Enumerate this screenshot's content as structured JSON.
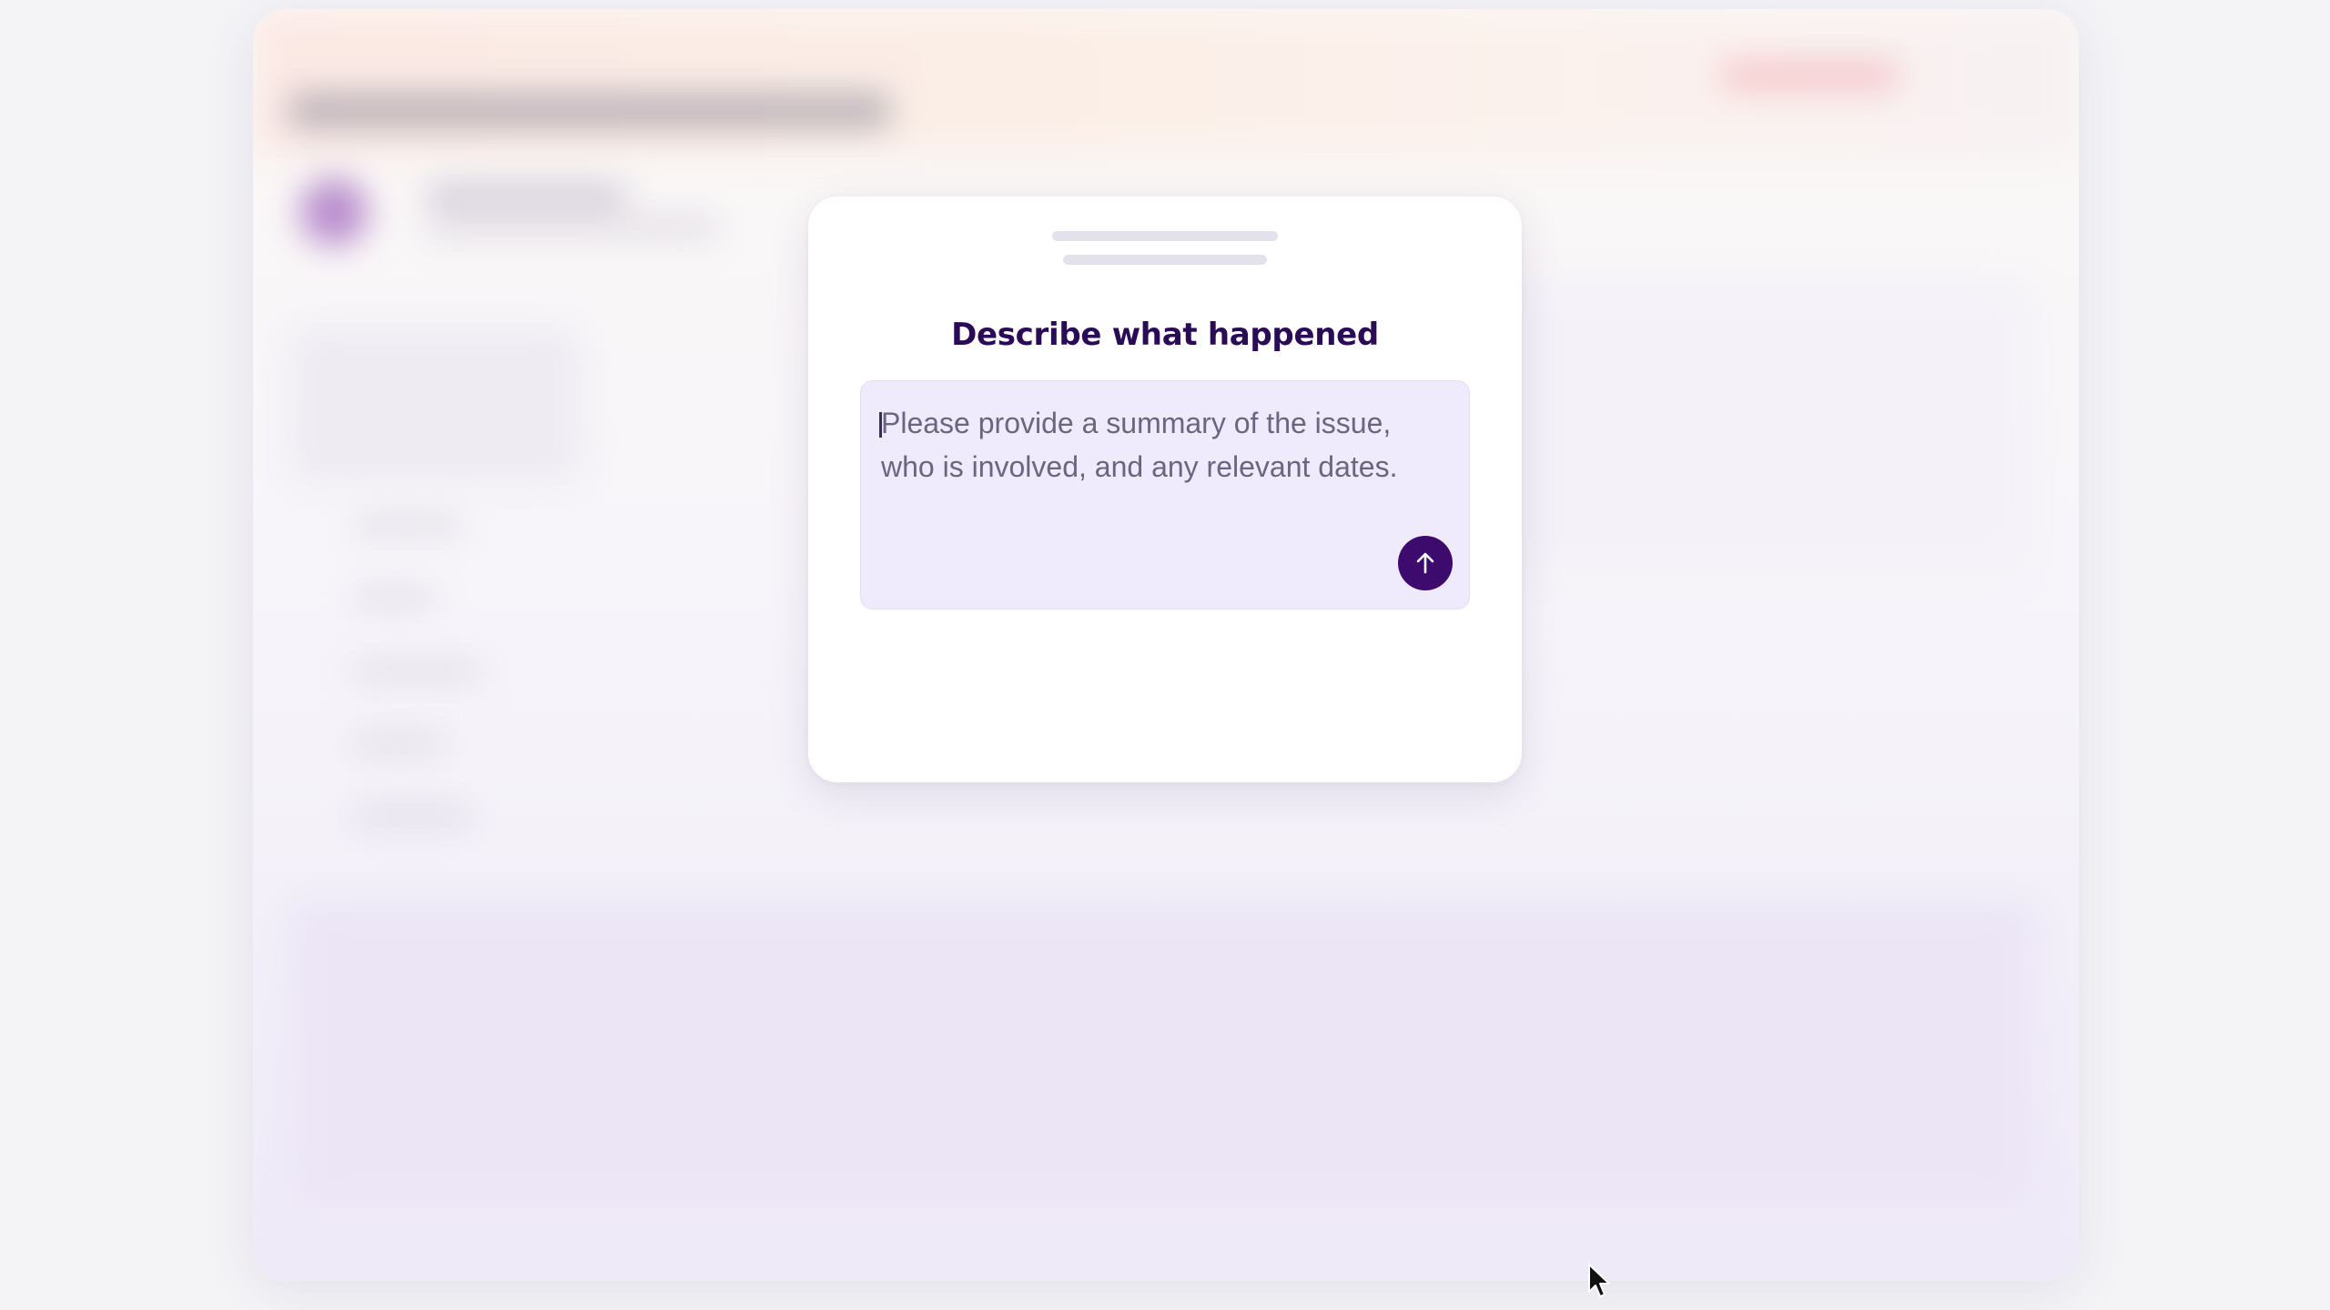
{
  "modal": {
    "title": "Describe what happened",
    "input": {
      "value": "",
      "placeholder": "Please provide a summary of the issue, who is involved, and any relevant dates."
    },
    "send_button": {
      "icon": "arrow-up-icon"
    }
  },
  "cursor": {
    "icon": "mouse-pointer-icon"
  },
  "colors": {
    "title": "#2a0b55",
    "accent": "#3d0a6e",
    "input_background": "#efebfc",
    "page_background": "#f4f4f7"
  }
}
